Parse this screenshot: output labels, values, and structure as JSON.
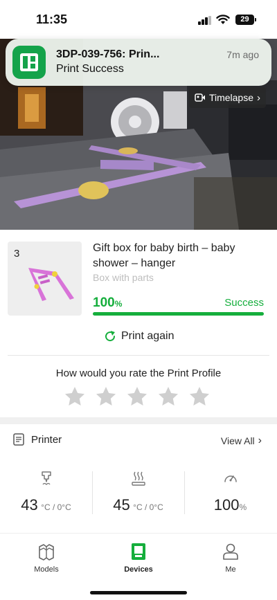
{
  "status_bar": {
    "time": "11:35",
    "battery": "29"
  },
  "notification": {
    "title": "3DP-039-756: Prin...",
    "body": "Print Success",
    "time": "7m ago"
  },
  "camera": {
    "timelapse_label": "Timelapse"
  },
  "task": {
    "plate_number": "3",
    "title": "Gift box for baby birth – baby shower – hanger",
    "subtitle": "Box with parts",
    "progress_value": "100",
    "progress_unit": "%",
    "progress_fraction": 1.0,
    "status": "Success",
    "print_again_label": "Print again"
  },
  "rating": {
    "prompt": "How would you rate the Print Profile",
    "stars_total": 5,
    "stars_selected": 0
  },
  "printer": {
    "label": "Printer",
    "view_all_label": "View All",
    "nozzle": {
      "value": "43",
      "unit": "°C / 0°C",
      "icon": "nozzle-icon"
    },
    "bed": {
      "value": "45",
      "unit": "°C / 0°C",
      "icon": "heatbed-icon"
    },
    "speed": {
      "value": "100",
      "unit": "%",
      "icon": "speedometer-icon"
    }
  },
  "tabs": [
    {
      "label": "Models",
      "icon": "models-icon",
      "active": false
    },
    {
      "label": "Devices",
      "icon": "devices-icon",
      "active": true
    },
    {
      "label": "Me",
      "icon": "person-icon",
      "active": false
    }
  ],
  "colors": {
    "accent": "#15ae3c",
    "app_icon": "#14a34a"
  }
}
